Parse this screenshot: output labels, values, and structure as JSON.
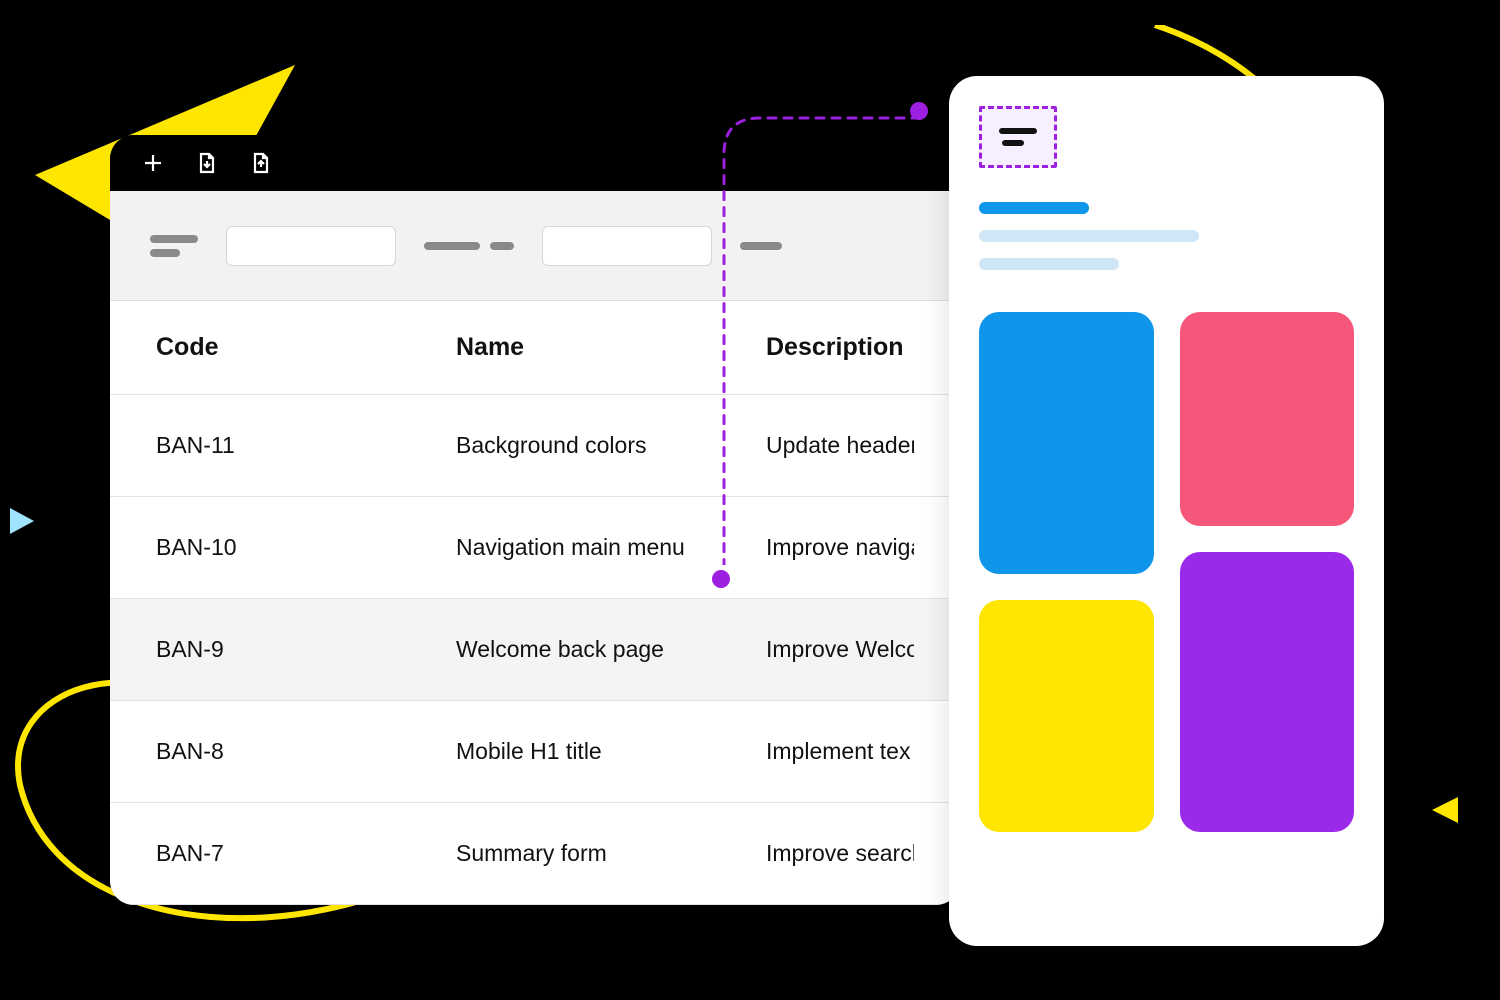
{
  "toolbar": {
    "add_icon": "add-icon",
    "download_icon": "download-icon",
    "upload_icon": "upload-icon"
  },
  "table": {
    "headers": {
      "code": "Code",
      "name": "Name",
      "description": "Description"
    },
    "rows": [
      {
        "code": "BAN-11",
        "name": "Background colors",
        "description": "Update headers"
      },
      {
        "code": "BAN-10",
        "name": "Navigation main menu",
        "description": "Improve naviga"
      },
      {
        "code": "BAN-9",
        "name": "Welcome back page",
        "description": "Improve Welco"
      },
      {
        "code": "BAN-8",
        "name": "Mobile H1 title",
        "description": "Implement  tex"
      },
      {
        "code": "BAN-7",
        "name": "Summary form",
        "description": "Improve search"
      }
    ]
  },
  "preview": {
    "selection_icon": "paragraph-icon",
    "tile_colors": {
      "blue": "#0f95ea",
      "pink": "#f5567a",
      "yellow": "#ffe600",
      "purple": "#9b29ea"
    }
  },
  "accent": {
    "connector": "#9d1fe0",
    "yellow": "#ffe600"
  }
}
